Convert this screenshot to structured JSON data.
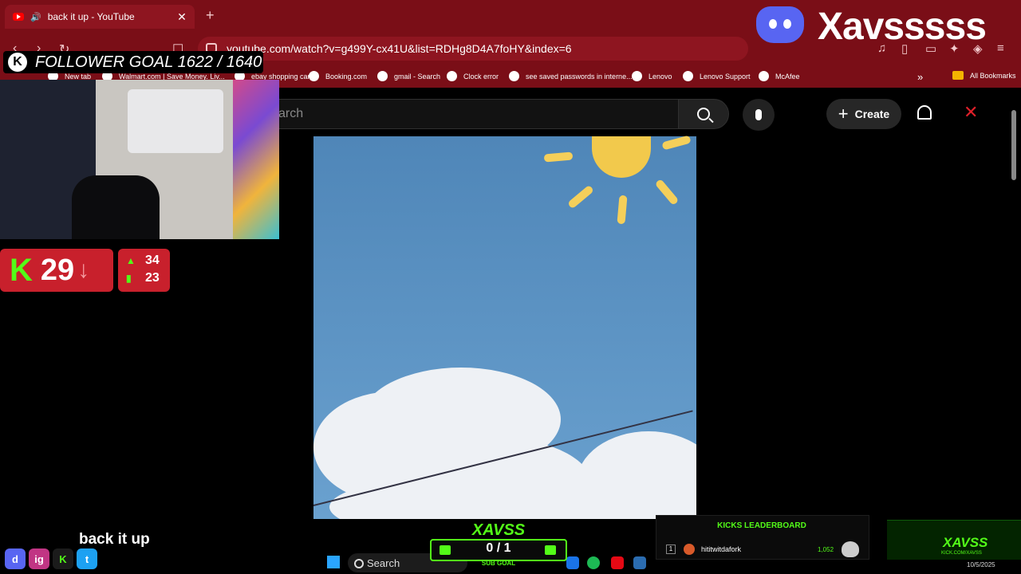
{
  "browser": {
    "tab_title": "back it up - YouTube",
    "tab_close": "✕",
    "new_tab": "+",
    "url": "youtube.com/watch?v=g499Y-cx41U&list=RDHg8D4A7foHY&index=6",
    "bookmarks": [
      "New tab",
      "Walmart.com | Save Money. Liv...",
      "ebay shopping cart",
      "Booking.com",
      "gmail - Search",
      "Clock error",
      "see saved passwords in interne...",
      "Lenovo",
      "Lenovo Support",
      "McAfee"
    ],
    "all_bookmarks": "All Bookmarks",
    "more": "»"
  },
  "youtube": {
    "search_placeholder": "arch",
    "create_label": "Create"
  },
  "overlay": {
    "follower_goal": "FOLLOWER GOAL 1622 / 1640",
    "k_badge": "K",
    "brand_name": "Xavsssss",
    "kick_count": "29",
    "kick_arrow": "↓",
    "stat_up": "34",
    "stat_bars": "23",
    "song_title": "back it up",
    "sub_goal_brand": "XAVSS",
    "sub_goal_value": "0 / 1",
    "sub_goal_label": "SUB GOAL",
    "leaderboard": {
      "title": "KICKS LEADERBOARD",
      "rank": "1",
      "user": "hititwitdafork",
      "amount": "1,052"
    },
    "brand_card_title": "XAVSS",
    "brand_card_sub": "KICK.COM/XAVSS",
    "socials": [
      "d",
      "ig",
      "K",
      "t"
    ]
  },
  "taskbar": {
    "search_label": "Search",
    "date": "10/5/2025"
  },
  "colors": {
    "browser_red": "#7a0e17",
    "kick_green": "#53fc18",
    "panel_red": "#c8202c",
    "discord_blue": "#5865f2"
  }
}
